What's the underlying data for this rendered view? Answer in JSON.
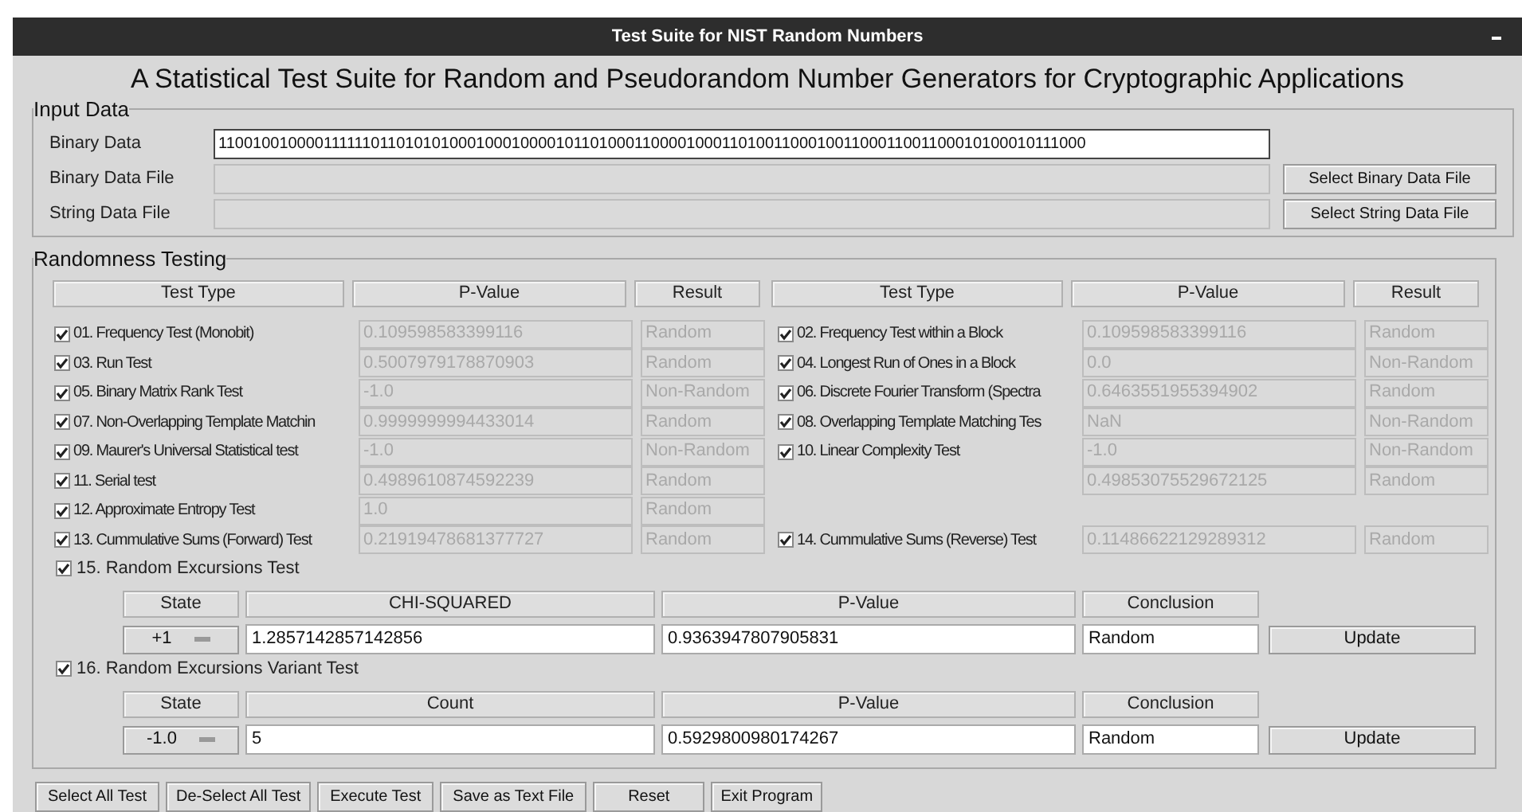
{
  "window": {
    "title": "Test Suite for NIST Random Numbers"
  },
  "heading": "A Statistical Test Suite for Random and Pseudorandom Number Generators for Cryptographic Applications",
  "input_data": {
    "legend": "Input Data",
    "rows": [
      {
        "label": "Binary Data",
        "value": "1100100100001111110110101010001000100001011010001100001000110100110001001100011001100010100010111000",
        "disabled": false
      },
      {
        "label": "Binary Data File",
        "disabled": true,
        "button": "Select Binary Data File"
      },
      {
        "label": "String Data File",
        "disabled": true,
        "button": "Select String Data File"
      }
    ]
  },
  "randomness_testing": {
    "legend": "Randomness Testing",
    "columns": [
      "Test Type",
      "P-Value",
      "Result",
      "Test Type",
      "P-Value",
      "Result"
    ],
    "rows": [
      {
        "left": {
          "label": "01. Frequency Test (Monobit)",
          "checked": true,
          "p_value": "0.109598583399116",
          "result": "Random"
        },
        "right": {
          "label": "02. Frequency Test within a Block",
          "checked": true,
          "p_value": "0.109598583399116",
          "result": "Random"
        }
      },
      {
        "left": {
          "label": "03. Run Test",
          "checked": true,
          "p_value": "0.5007979178870903",
          "result": "Random"
        },
        "right": {
          "label": "04. Longest Run of Ones in a Block",
          "checked": true,
          "p_value": "0.0",
          "result": "Non-Random"
        }
      },
      {
        "left": {
          "label": "05. Binary Matrix Rank Test",
          "checked": true,
          "p_value": "-1.0",
          "result": "Non-Random"
        },
        "right": {
          "label": "06. Discrete Fourier Transform (Spectra",
          "checked": true,
          "p_value": "0.6463551955394902",
          "result": "Random"
        }
      },
      {
        "left": {
          "label": "07. Non-Overlapping Template Matchin",
          "checked": true,
          "p_value": "0.9999999994433014",
          "result": "Random"
        },
        "right": {
          "label": "08. Overlapping Template Matching Tes",
          "checked": true,
          "p_value": "NaN",
          "result": "Non-Random"
        }
      },
      {
        "left": {
          "label": "09. Maurer's Universal Statistical test",
          "checked": true,
          "p_value": "-1.0",
          "result": "Non-Random"
        },
        "right": {
          "label": "10. Linear Complexity Test",
          "checked": true,
          "p_value": "-1.0",
          "result": "Non-Random"
        }
      },
      {
        "left": {
          "label": "11. Serial test",
          "checked": true,
          "p_value": "0.4989610874592239",
          "result": "Random"
        },
        "right": {
          "p_value": "0.49853075529672125",
          "result": "Random"
        }
      },
      {
        "left": {
          "label": "12. Approximate Entropy Test",
          "checked": true,
          "p_value": "1.0",
          "result": "Random"
        }
      },
      {
        "left": {
          "label": "13. Cummulative Sums (Forward) Test",
          "checked": true,
          "p_value": "0.21919478681377727",
          "result": "Random"
        },
        "right": {
          "label": "14. Cummulative Sums (Reverse) Test",
          "checked": true,
          "p_value": "0.11486622129289312",
          "result": "Random"
        }
      }
    ],
    "excursions": [
      {
        "label": "15. Random Excursions Test",
        "checked": true,
        "columns": [
          "State",
          "CHI-SQUARED",
          "P-Value",
          "Conclusion"
        ],
        "state": "+1",
        "statistic": "1.2857142857142856",
        "p_value": "0.9363947807905831",
        "conclusion": "Random",
        "button": "Update"
      },
      {
        "label": "16. Random Excursions Variant Test",
        "checked": true,
        "columns": [
          "State",
          "Count",
          "P-Value",
          "Conclusion"
        ],
        "state": "-1.0",
        "statistic": "5",
        "p_value": "0.5929800980174267",
        "conclusion": "Random",
        "button": "Update"
      }
    ]
  },
  "buttons": [
    "Select All Test",
    "De-Select All Test",
    "Execute Test",
    "Save as Text File",
    "Reset",
    "Exit Program"
  ]
}
